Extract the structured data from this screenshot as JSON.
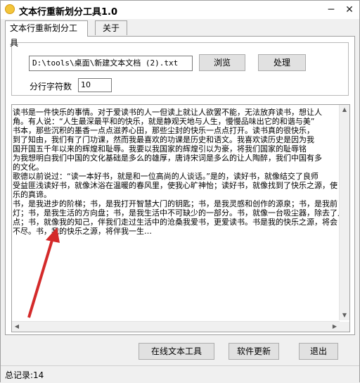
{
  "window": {
    "title": "文本行重新划分工具1.0",
    "minimize": "─",
    "close": "✕"
  },
  "tabs": [
    {
      "label": "文本行重新划分工具",
      "active": true
    },
    {
      "label": "关于",
      "active": false
    }
  ],
  "file": {
    "path": "D:\\tools\\桌面\\新建文本文档 (2).txt",
    "browse_label": "浏览",
    "process_label": "处理"
  },
  "split": {
    "label": "分行字符数",
    "value": "10"
  },
  "content": {
    "lines": [
      "读书是一件快乐的事情。对于爱读书的人一但读上就让人欲罢不能，无法放弃读书，想让人",
      "角。有人说：“人生最深最平和的快乐，就是静观天地与人生，慢慢品味出它的和谐与美”",
      "书本，那些沉积的墨香一点点滋养心田，那些尘封的快乐一点点打开。读书真的很快乐，",
      "到了知由，我们有了门功课，然而我最喜欢的功课是历史和语文。我喜欢读历史是因为我",
      "国开国五千年以来的辉煌和耻辱。我要以我国家的辉煌引以为豪，将我们国家的耻辱铭",
      "为我想明白我们中国的文化基础是多么的雄厚，唐诗宋词是多么的让人陶醉，我们中国有多",
      "的文化。",
      "歌德以前说过：“读一本好书，就是和一位高尚的人谈话。”是的，读好书，就像结交了良师",
      "受益匪浅读好书，就像沐浴在温暖的春风里，使我心旷神怡；读好书，就像找到了快乐之源，使",
      "乐的真谛。",
      "书，是我进步的阶梯；书，是我打开智慧大门的钥匙；书，是我灵感和创作的源泉；书，是我前",
      "灯；书，是我生活的方向盘；书，是我生活中不可缺少的一部分。书，就像一台吸尘器，除去了人",
      "点；书，就像我的知己，伴我们走过生活中的沧桑我爱书，更爱读书。书是我的快乐之源，将会",
      "不尽。书，我的快乐之源，将伴我一生…"
    ]
  },
  "buttons": {
    "online_tools": "在线文本工具",
    "update": "软件更新",
    "exit": "退出"
  },
  "status": {
    "text": "总记录:14"
  },
  "colors": {
    "annotation_arrow": "#d42a2a"
  }
}
